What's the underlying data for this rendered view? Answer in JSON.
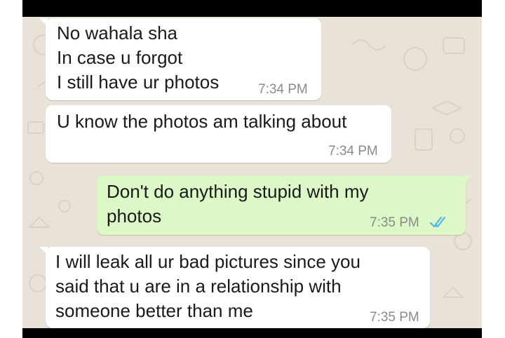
{
  "messages": [
    {
      "direction": "incoming",
      "lines": [
        "No wahala sha",
        "In case u forgot",
        "I still have ur photos"
      ],
      "time": "7:34 PM"
    },
    {
      "direction": "incoming",
      "lines": [
        "U know the photos am talking about"
      ],
      "time": "7:34 PM"
    },
    {
      "direction": "outgoing",
      "lines": [
        "Don't do anything stupid with my",
        "photos"
      ],
      "time": "7:35 PM",
      "status_icon": "double-check-read-icon"
    },
    {
      "direction": "incoming",
      "lines": [
        "I will leak all ur bad pictures since you",
        "said that u are in a relationship with",
        "someone better than me"
      ],
      "time": "7:35 PM"
    }
  ],
  "colors": {
    "wallpaper": "#e8e2d9",
    "incoming_bubble": "#ffffff",
    "outgoing_bubble": "#dcf8c6",
    "timestamp": "#8a8a8a",
    "read_ticks": "#4fb6ec",
    "letterbox": "#000000"
  }
}
